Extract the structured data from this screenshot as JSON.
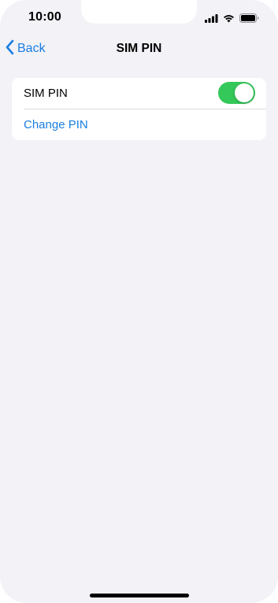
{
  "status_bar": {
    "time": "10:00",
    "icons": [
      "signal-icon",
      "wifi-icon",
      "battery-icon"
    ]
  },
  "nav": {
    "back_label": "Back",
    "title": "SIM PIN"
  },
  "settings": {
    "sim_pin_label": "SIM PIN",
    "sim_pin_enabled": true,
    "change_pin_label": "Change PIN"
  },
  "colors": {
    "accent": "#1a7ee0",
    "toggle_on": "#34c759",
    "background": "#f2f2f7"
  }
}
